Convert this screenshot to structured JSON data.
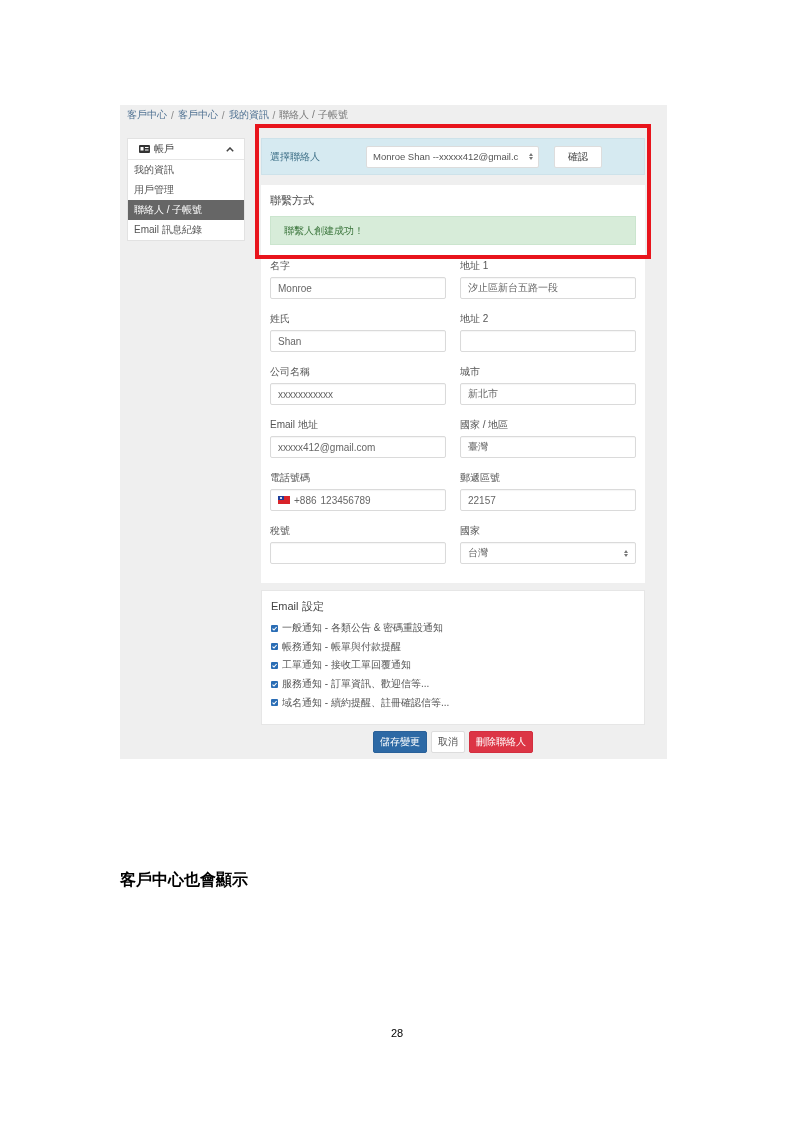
{
  "breadcrumb": {
    "separator": "/",
    "items": [
      "客戶中心",
      "客戶中心",
      "我的資訊",
      "聯絡人 / 子帳號"
    ]
  },
  "sidebar": {
    "title": "帳戶",
    "expanded": true,
    "items": [
      {
        "label": "我的資訊",
        "selected": false
      },
      {
        "label": "用戶管理",
        "selected": false
      },
      {
        "label": "聯絡人 / 子帳號",
        "selected": true
      },
      {
        "label": "Email 訊息紀錄",
        "selected": false
      }
    ]
  },
  "contact_picker": {
    "label": "選擇聯絡人",
    "value": "Monroe Shan --xxxxx412@gmail.c",
    "button": "確認",
    "highlighted": true
  },
  "contact_info": {
    "title": "聯繫方式",
    "alert": "聯繫人創建成功！",
    "fields": [
      {
        "label": "名字",
        "kind": "text",
        "value": "Monroe"
      },
      {
        "label": "地址 1",
        "kind": "text",
        "value": "汐止區新台五路一段"
      },
      {
        "label": "姓氏",
        "kind": "text",
        "value": "Shan"
      },
      {
        "label": "地址 2",
        "kind": "text"
      },
      {
        "label": "公司名稱",
        "kind": "text",
        "value": "xxxxxxxxxxx"
      },
      {
        "label": "城市",
        "kind": "text",
        "value": "新北市"
      },
      {
        "label": "Email 地址",
        "kind": "text",
        "value": "xxxxx412@gmail.com"
      },
      {
        "label": "國家 / 地區",
        "kind": "text",
        "value": "臺灣"
      },
      {
        "label": "電話號碼",
        "kind": "phone",
        "prefix": "+886",
        "value": "123456789"
      },
      {
        "label": "郵遞區號",
        "kind": "text",
        "value": "22157"
      },
      {
        "label": "稅號",
        "kind": "text"
      },
      {
        "label": "國家",
        "kind": "select",
        "value": "台灣"
      }
    ]
  },
  "email_settings": {
    "title": "Email 設定",
    "options": [
      {
        "label": "一般通知 - 各類公告 & 密碼重設通知",
        "checked": true
      },
      {
        "label": "帳務通知 - 帳單與付款提醒",
        "checked": true
      },
      {
        "label": "工單通知 - 接收工單回覆通知",
        "checked": true
      },
      {
        "label": "服務通知 - 訂單資訊、歡迎信等...",
        "checked": true
      },
      {
        "label": "域名通知 - 續約提醒、註冊確認信等...",
        "checked": true
      }
    ]
  },
  "actions": [
    {
      "label": "儲存變更",
      "kind": "primary"
    },
    {
      "label": "取消",
      "kind": "default"
    },
    {
      "label": "刪除聯絡人",
      "kind": "danger"
    }
  ],
  "caption": "客戶中心也會顯示",
  "page_number": "28"
}
